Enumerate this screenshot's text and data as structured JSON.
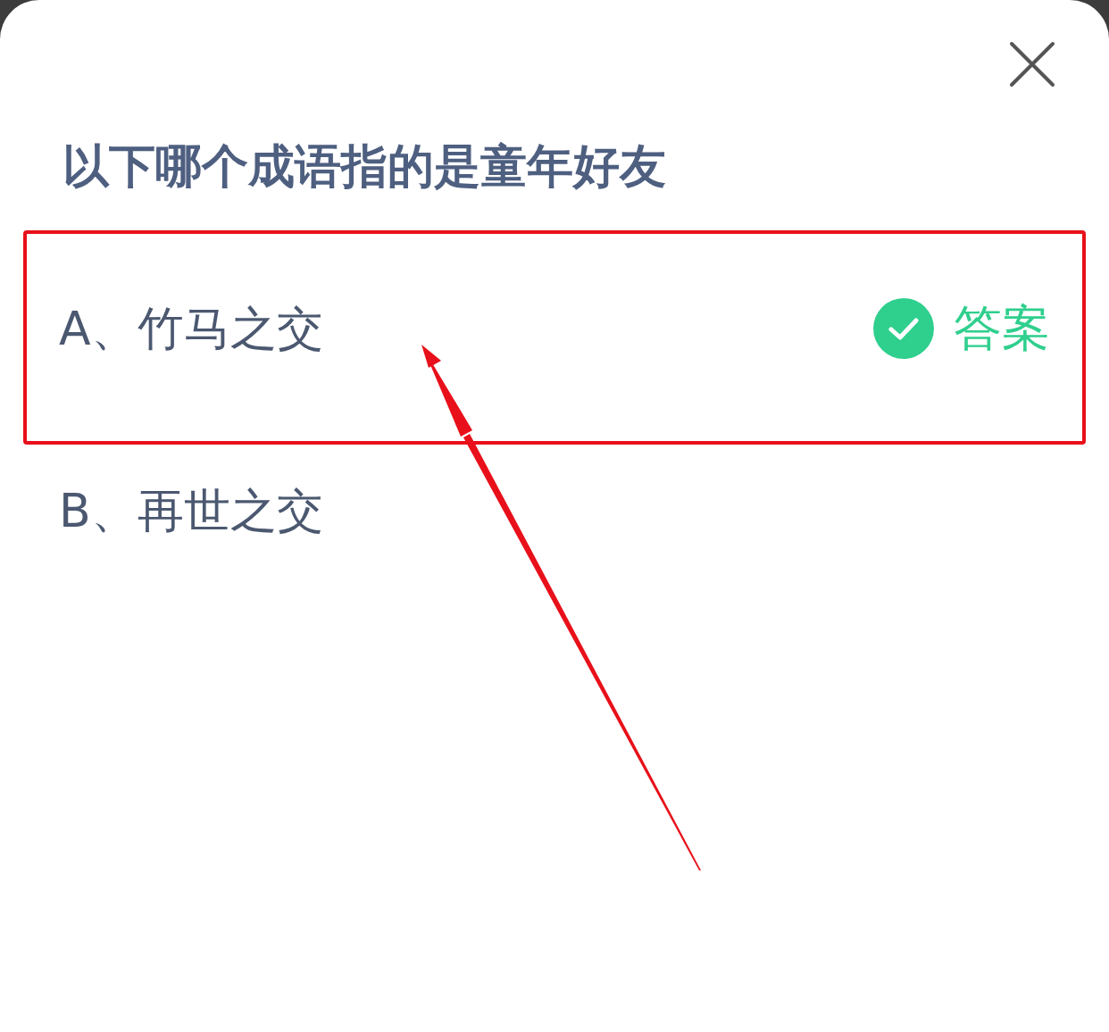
{
  "question": "以下哪个成语指的是童年好友",
  "options": [
    {
      "label": "A、竹马之交",
      "correct": true,
      "highlighted": true
    },
    {
      "label": "B、再世之交",
      "correct": false,
      "highlighted": false
    }
  ],
  "answer_label": "答案"
}
